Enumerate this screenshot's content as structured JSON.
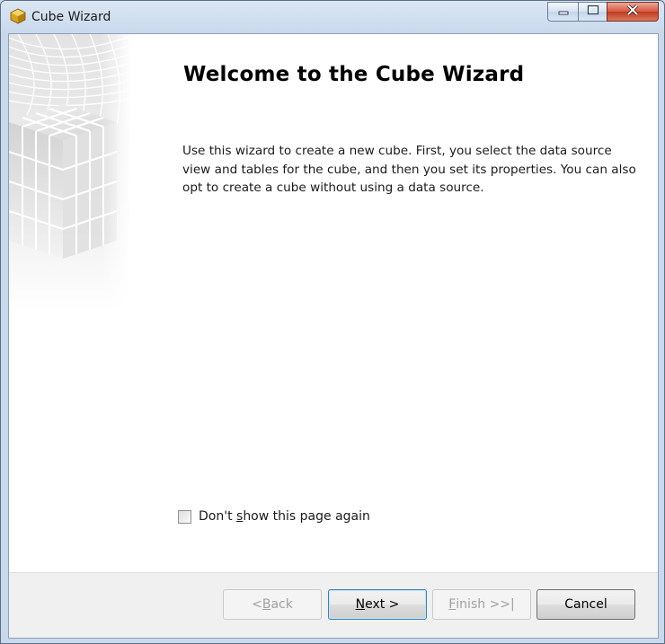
{
  "window": {
    "title": "Cube Wizard",
    "app_icon": "cube-icon",
    "caption_buttons": [
      "minimize-icon",
      "maximize-icon",
      "close-icon"
    ]
  },
  "welcome": {
    "title": "Welcome to the Cube Wizard",
    "description": "Use this wizard to create a new cube. First, you select the data source view and tables for the cube, and then you set its properties. You can also opt to create a cube without using a data source."
  },
  "options": {
    "dont_show_label_pre": "Don't ",
    "dont_show_label_accel": "s",
    "dont_show_label_post": "how this page again",
    "dont_show_checked": false
  },
  "buttons": {
    "back_pre": "< ",
    "back_accel": "B",
    "back_post": "ack",
    "back_enabled": false,
    "next_accel": "N",
    "next_post": "ext >",
    "next_enabled": true,
    "finish_accel": "F",
    "finish_post": "inish >>|",
    "finish_enabled": false,
    "cancel": "Cancel",
    "cancel_enabled": true
  },
  "colors": {
    "accent": "#3c7fb1",
    "close_red": "#c23a22",
    "frame": "#c9d9ec"
  }
}
